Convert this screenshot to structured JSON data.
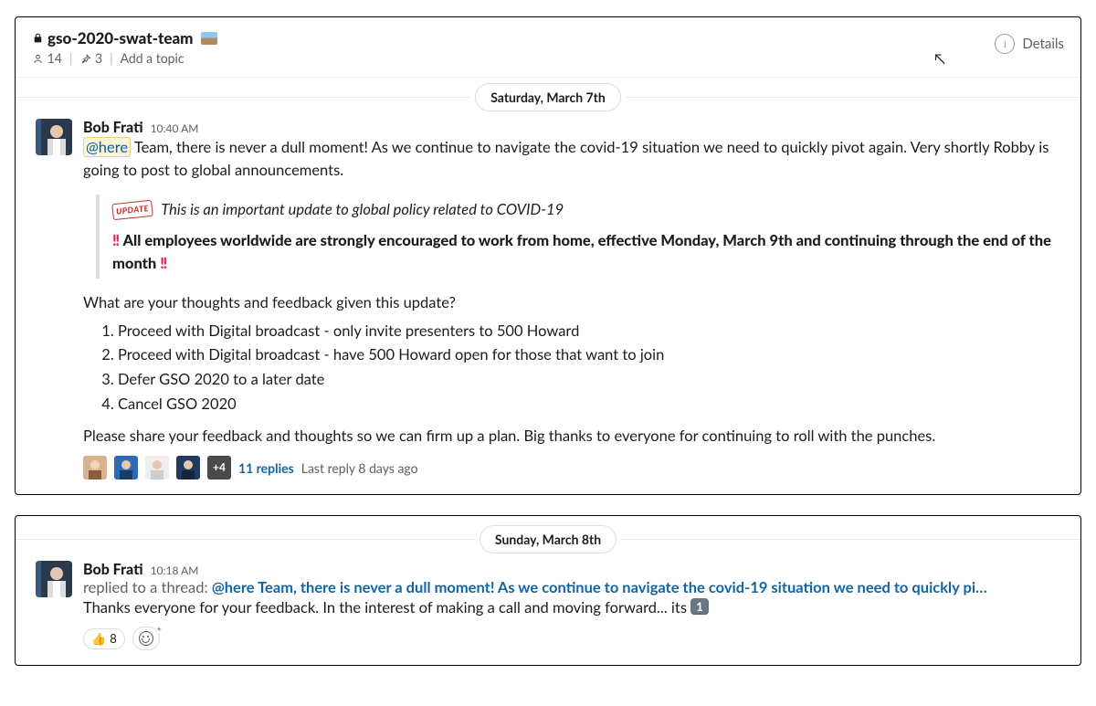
{
  "header": {
    "channel_name": "gso-2020-swat-team",
    "member_count": "14",
    "pinned_count": "3",
    "add_topic": "Add a topic",
    "details_label": "Details"
  },
  "panel1": {
    "date_label": "Saturday, March 7th",
    "author": "Bob Frati",
    "time": "10:40 AM",
    "mention": "@here",
    "body_after_mention": " Team, there is never a dull moment! As we continue to navigate the covid-19 situation we need to quickly pivot again. Very shortly Robby is going to post to global announcements.",
    "quote": {
      "stamp": "UPDATE",
      "line1": "This is an important update to global policy related to COVID-19",
      "bangbang": "‼",
      "line2_mid": " All employees worldwide are strongly encouraged to work from home, effective Monday, March 9th and continuing through the end of the month "
    },
    "followup": "What are your thoughts and feedback given this update?",
    "options": [
      "Proceed with Digital broadcast - only invite presenters to 500 Howard",
      "Proceed with Digital broadcast - have 500 Howard open for those that want to join",
      "Defer GSO 2020 to a later date",
      "Cancel GSO 2020"
    ],
    "closing": "Please share your feedback and thoughts so we can firm up a plan. Big thanks to everyone for continuing to roll with the punches.",
    "thread": {
      "overflow": "+4",
      "replies_link": "11 replies",
      "last_reply": "Last reply 8 days ago"
    }
  },
  "panel2": {
    "date_label": "Sunday, March 8th",
    "author": "Bob Frati",
    "time": "10:18 AM",
    "context_prefix": "replied to a thread: ",
    "context_link": "@here Team, there is never a dull moment! As we continue to navigate the covid-19 situation we need to quickly pi…",
    "reply_body": "Thanks everyone for your feedback. In the interest of making a call and moving forward... its ",
    "keycap": "1",
    "reaction": {
      "emoji": "👍",
      "count": "8"
    }
  }
}
